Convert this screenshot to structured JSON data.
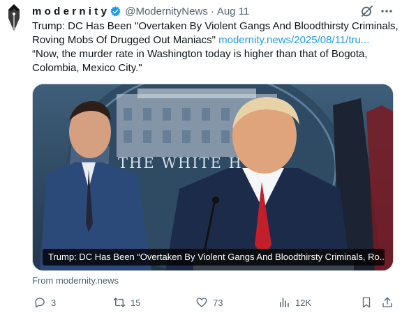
{
  "account": {
    "display_name": "modernity",
    "handle": "@ModernityNews",
    "time": "Aug 11",
    "dot": "·"
  },
  "tweet": {
    "line1": "Trump: DC Has Been \"Overtaken By Violent Gangs And Bloodthirsty Criminals,",
    "line2_text": "Roving Mobs Of Drugged Out Maniacs\"",
    "line2_link": "modernity.news/2025/08/11/tru...",
    "line3": "“Now, the murder rate in Washington today is higher than that of Bogota,",
    "line4": "Colombia, Mexico City.\""
  },
  "media": {
    "caption": "Trump: DC Has Been “Overtaken By Violent Gangs And Bloodthirsty Criminals, Ro...",
    "backdrop_text": "THE WHITE H"
  },
  "source_label": "From modernity.news",
  "actions": {
    "replies": "3",
    "reposts": "15",
    "likes": "73",
    "views": "12K"
  },
  "icons": {
    "avatar": "fountain-pen-logo",
    "verified": "verified-badge-icon",
    "grok": "grok-icon",
    "more": "more-icon",
    "reply": "reply-icon",
    "repost": "repost-icon",
    "like": "heart-icon",
    "views": "views-icon",
    "bookmark": "bookmark-icon",
    "share": "share-icon"
  },
  "colors": {
    "link": "#1d9bf0",
    "verified": "#1d9bf0",
    "secondary_text": "#536471"
  }
}
